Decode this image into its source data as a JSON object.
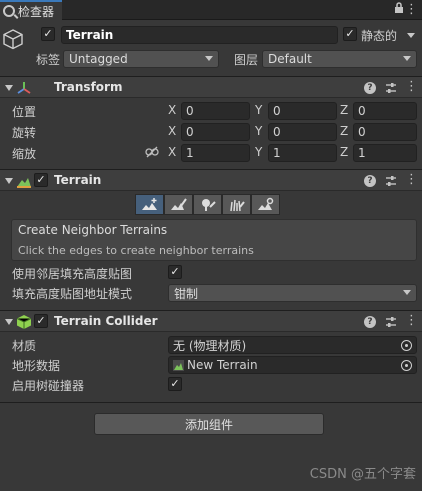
{
  "tab": {
    "label": "检查器"
  },
  "header": {
    "object_name": "Terrain",
    "static_label": "静态的",
    "tag_label": "标签",
    "tag_value": "Untagged",
    "layer_label": "图层",
    "layer_value": "Default"
  },
  "transform": {
    "title": "Transform",
    "rows": [
      {
        "label": "位置",
        "x": "0",
        "y": "0",
        "z": "0"
      },
      {
        "label": "旋转",
        "x": "0",
        "y": "0",
        "z": "0"
      },
      {
        "label": "缩放",
        "x": "1",
        "y": "1",
        "z": "1"
      }
    ],
    "axis_x": "X",
    "axis_y": "Y",
    "axis_z": "Z"
  },
  "terrain": {
    "title": "Terrain",
    "tool_title": "Create Neighbor Terrains",
    "tool_description": "Click the edges to create neighbor terrains",
    "fill_heightmap_label": "使用邻居填充高度贴图",
    "address_mode_label": "填充高度贴图地址模式",
    "address_mode_value": "钳制"
  },
  "terrain_collider": {
    "title": "Terrain Collider",
    "material_label": "材质",
    "material_value": "无 (物理材质)",
    "terrain_data_label": "地形数据",
    "terrain_data_value": "New Terrain",
    "tree_colliders_label": "启用树碰撞器"
  },
  "add_component": {
    "label": "添加组件"
  },
  "watermark": "CSDN @五个字套",
  "colors": {
    "background": "#383838",
    "field": "#2a2a2a",
    "active_tool": "#46607c",
    "accent": "#3a79bb"
  }
}
